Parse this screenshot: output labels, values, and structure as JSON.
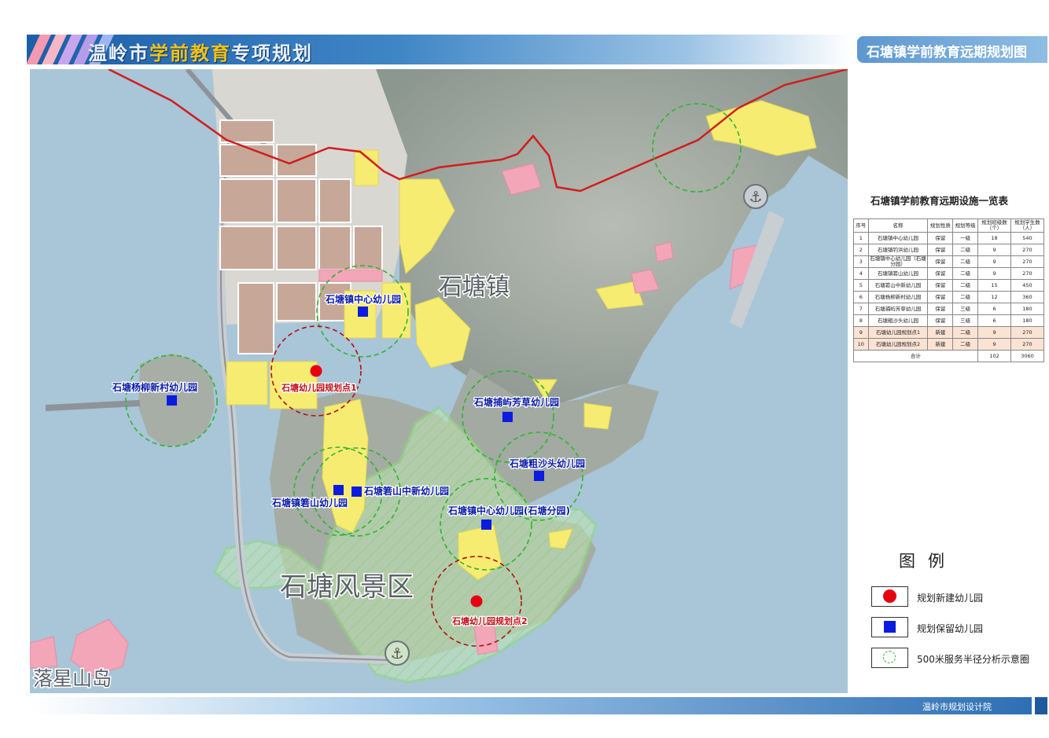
{
  "header": {
    "title_part1": "温岭市",
    "title_part2": "学前教育",
    "title_part3": "专项规划",
    "map_title": "石塘镇学前教育远期规划图"
  },
  "map": {
    "place_labels": {
      "town": "石塘镇",
      "scenic_area": "石塘风景区",
      "island": "落星山岛"
    },
    "facilities": [
      {
        "label": "石塘镇中心幼儿园",
        "type": "retained"
      },
      {
        "label": "石塘杨柳新村幼儿园",
        "type": "retained"
      },
      {
        "label": "石塘幼儿园规划点1",
        "type": "new"
      },
      {
        "label": "石塘捕屿芳草幼儿园",
        "type": "retained"
      },
      {
        "label": "石塘粗沙头幼儿园",
        "type": "retained"
      },
      {
        "label": "石塘箬山中新幼儿园",
        "type": "retained"
      },
      {
        "label": "石塘镇箬山幼儿园",
        "type": "retained"
      },
      {
        "label": "石塘镇中心幼儿园(石塘分园)",
        "type": "retained"
      },
      {
        "label": "石塘幼儿园规划点2",
        "type": "new"
      }
    ],
    "colors": {
      "sea": "#a9c5d8",
      "residential": "#f7ec72",
      "commercial": "#f2a6b8",
      "industrial": "#c7a898",
      "boundary": "#d11d1d",
      "scenic": "#8fdc7a",
      "retained_marker": "#0b1ce0",
      "new_marker": "#e60012",
      "retained_circle": "#2db52d",
      "new_circle": "#b01010"
    }
  },
  "table": {
    "title": "石塘镇学前教育远期设施一览表",
    "headers": [
      "序号",
      "名称",
      "规划性质",
      "规划等级",
      "规划班级数（个）",
      "规划学生数（人）"
    ],
    "rows": [
      [
        "1",
        "石塘镇中心幼儿园",
        "保留",
        "一级",
        "18",
        "540"
      ],
      [
        "2",
        "石塘镇钓浜幼儿园",
        "保留",
        "二级",
        "9",
        "270"
      ],
      [
        "3",
        "石塘镇中心幼儿园（石塘分园）",
        "保留",
        "二级",
        "9",
        "270"
      ],
      [
        "4",
        "石塘镇箬山幼儿园",
        "保留",
        "二级",
        "9",
        "270"
      ],
      [
        "5",
        "石塘箬山中新幼儿园",
        "保留",
        "二级",
        "15",
        "450"
      ],
      [
        "6",
        "石塘杨柳新村幼儿园",
        "保留",
        "二级",
        "12",
        "360"
      ],
      [
        "7",
        "石塘捕屿芳草幼儿园",
        "保留",
        "三级",
        "6",
        "180"
      ],
      [
        "8",
        "石塘粗沙头幼儿园",
        "保留",
        "三级",
        "6",
        "180"
      ],
      [
        "9",
        "石塘幼儿园规划点1",
        "新建",
        "二级",
        "9",
        "270"
      ],
      [
        "10",
        "石塘幼儿园规划点2",
        "新建",
        "二级",
        "9",
        "270"
      ]
    ],
    "total": {
      "label": "合计",
      "classes": "102",
      "students": "3060"
    }
  },
  "legend": {
    "title": "图例",
    "items": [
      {
        "label": "规划新建幼儿园",
        "color": "#e60012"
      },
      {
        "label": "规划保留幼儿园",
        "color": "#0b1ce0"
      },
      {
        "label": "500米服务半径分析示意圈",
        "color": "#2db52d"
      }
    ]
  },
  "footer": {
    "organization": "温岭市规划设计院"
  }
}
